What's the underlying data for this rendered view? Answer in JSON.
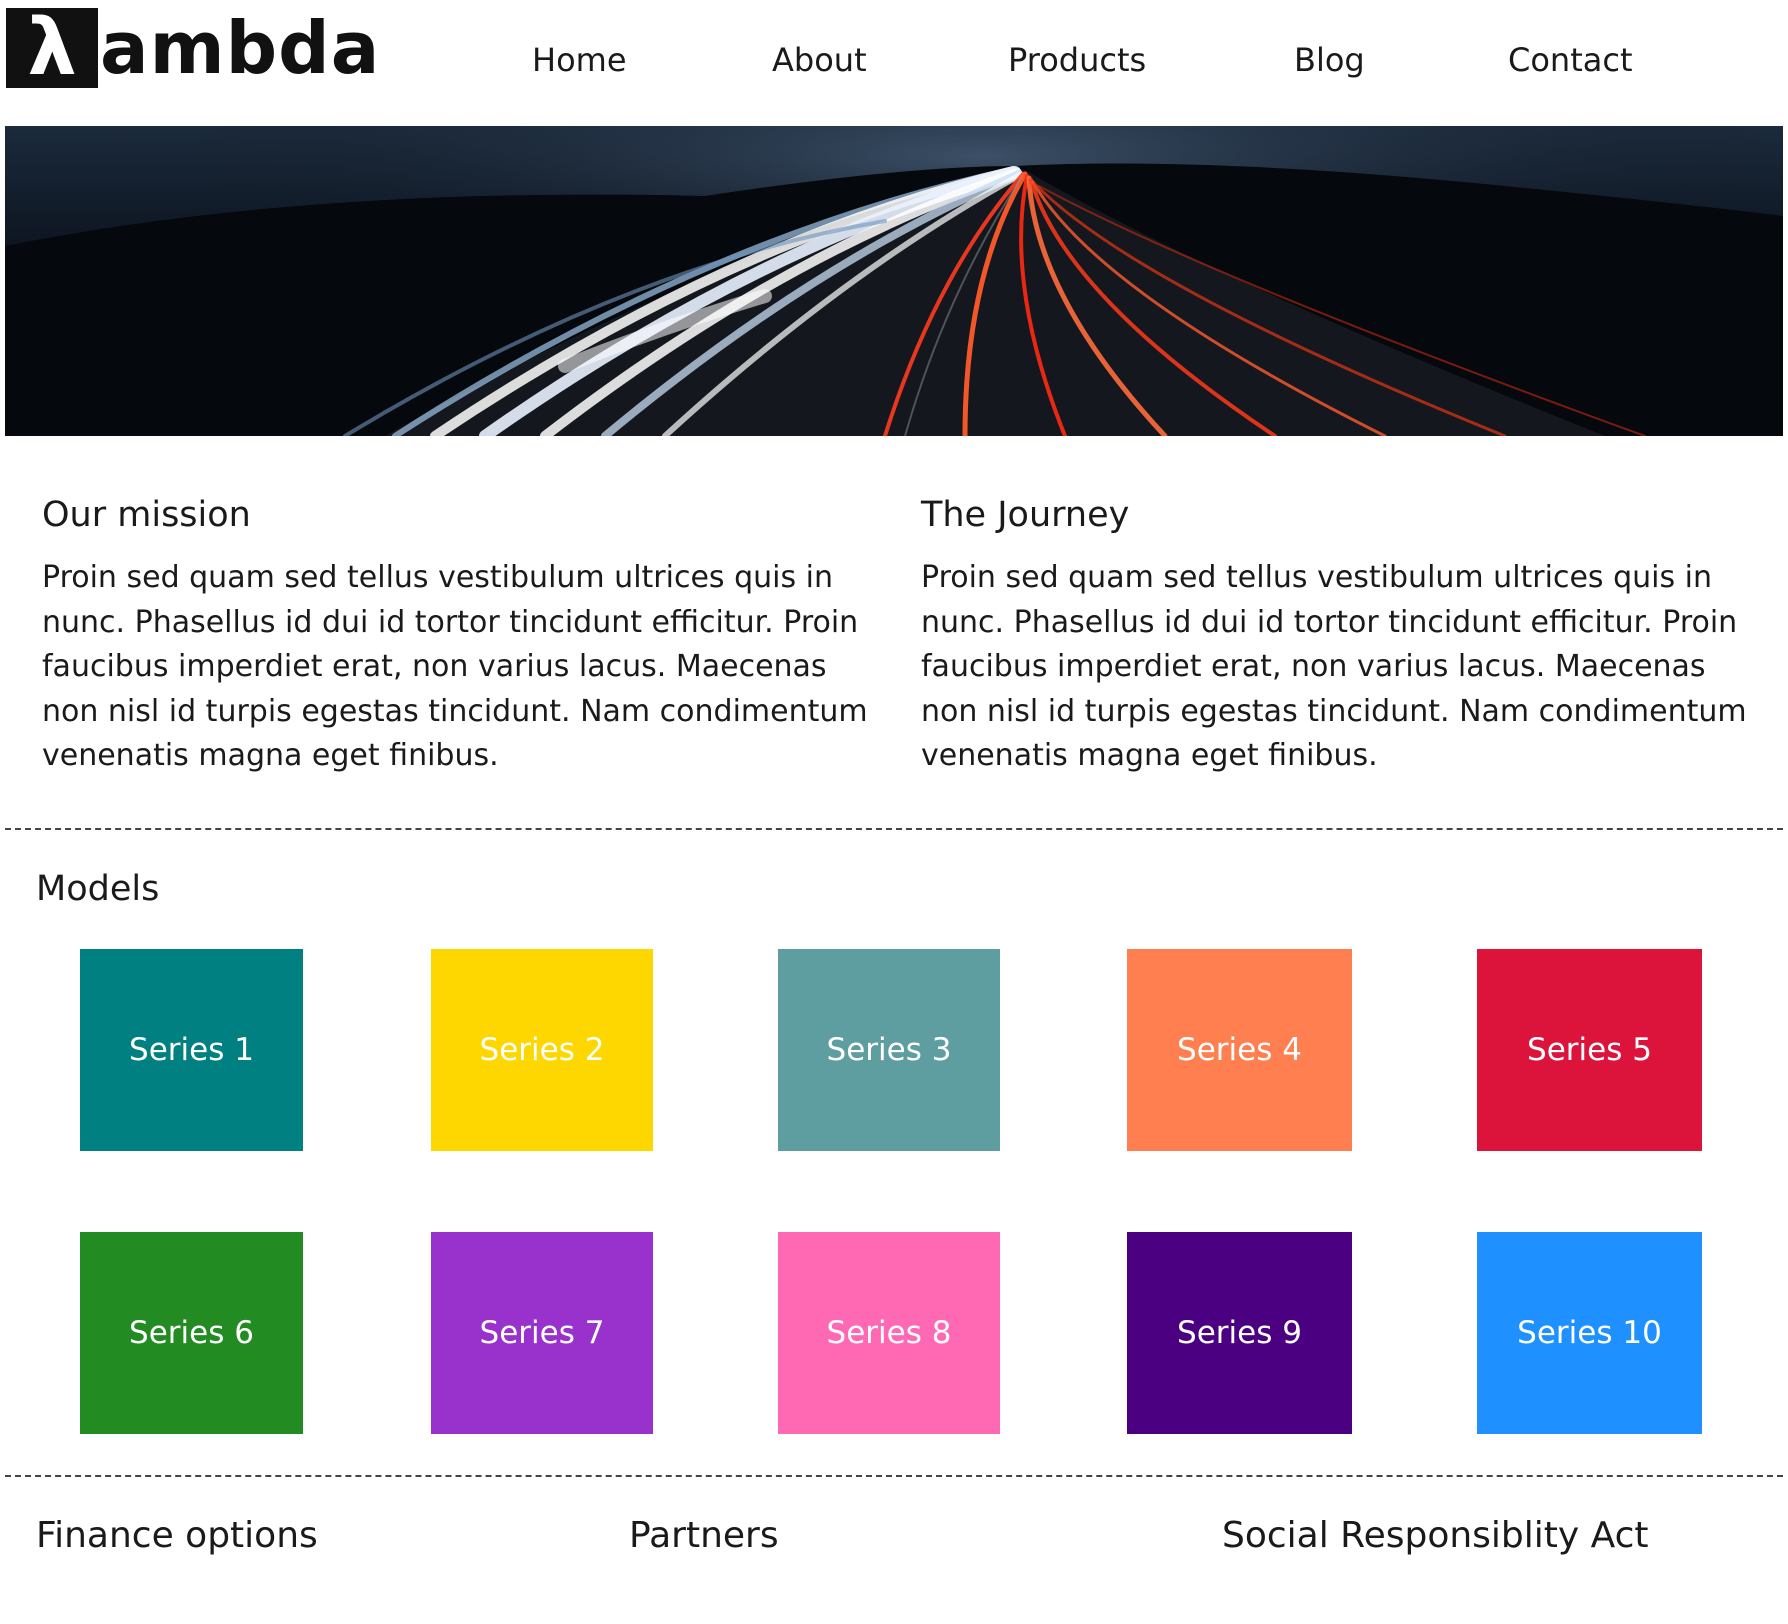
{
  "brand": {
    "logo_letter": "λ",
    "logo_text": "ambda"
  },
  "nav": {
    "items": [
      {
        "label": "Home"
      },
      {
        "label": "About"
      },
      {
        "label": "Products"
      },
      {
        "label": "Blog"
      },
      {
        "label": "Contact"
      }
    ]
  },
  "hero": {
    "image": "night-highway-light-trails"
  },
  "mission": {
    "title": "Our mission",
    "body": "Proin sed quam sed tellus vestibulum ultrices quis in nunc. Phasellus id dui id tortor tincidunt efficitur. Proin faucibus imperdiet erat, non varius lacus. Maecenas non nisl id turpis egestas tincidunt. Nam condimentum venenatis magna eget finibus."
  },
  "journey": {
    "title": "The Journey",
    "body": "Proin sed quam sed tellus vestibulum ultrices quis in nunc. Phasellus id dui id tortor tincidunt efficitur. Proin faucibus imperdiet erat, non varius lacus. Maecenas non nisl id turpis egestas tincidunt. Nam condimentum venenatis magna eget finibus."
  },
  "models": {
    "title": "Models",
    "tiles": [
      {
        "label": "Series 1",
        "color": "#008080"
      },
      {
        "label": "Series 2",
        "color": "#FFD700"
      },
      {
        "label": "Series 3",
        "color": "#5F9EA0"
      },
      {
        "label": "Series 4",
        "color": "#FF7F50"
      },
      {
        "label": "Series 5",
        "color": "#DC143C"
      },
      {
        "label": "Series 6",
        "color": "#228B22"
      },
      {
        "label": "Series 7",
        "color": "#9932CC"
      },
      {
        "label": "Series 8",
        "color": "#FF69B4"
      },
      {
        "label": "Series 9",
        "color": "#4B0082"
      },
      {
        "label": "Series 10",
        "color": "#1E90FF"
      }
    ]
  },
  "footer": {
    "items": [
      {
        "label": "Finance options"
      },
      {
        "label": "Partners"
      },
      {
        "label": "Social Responsiblity Act"
      }
    ]
  }
}
